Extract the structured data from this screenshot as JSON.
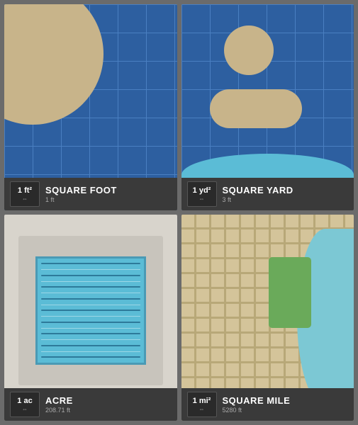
{
  "panels": {
    "p1": {
      "title": "SQUARE FOOT",
      "subtitle": "1 ft",
      "badge_main": "1 ft²",
      "badge_arrows": "⇔"
    },
    "p2": {
      "title": "SQUARE YARD",
      "subtitle": "3 ft",
      "badge_main": "1 yd²",
      "badge_arrows": "⇔"
    },
    "p3": {
      "title": "ACRE",
      "subtitle": "208.71 ft",
      "badge_main": "1 ac",
      "badge_arrows": "⇔"
    },
    "p4": {
      "title": "SQUARE MILE",
      "subtitle": "5280 ft",
      "badge_main": "1 mi²",
      "badge_arrows": "⇔"
    }
  }
}
